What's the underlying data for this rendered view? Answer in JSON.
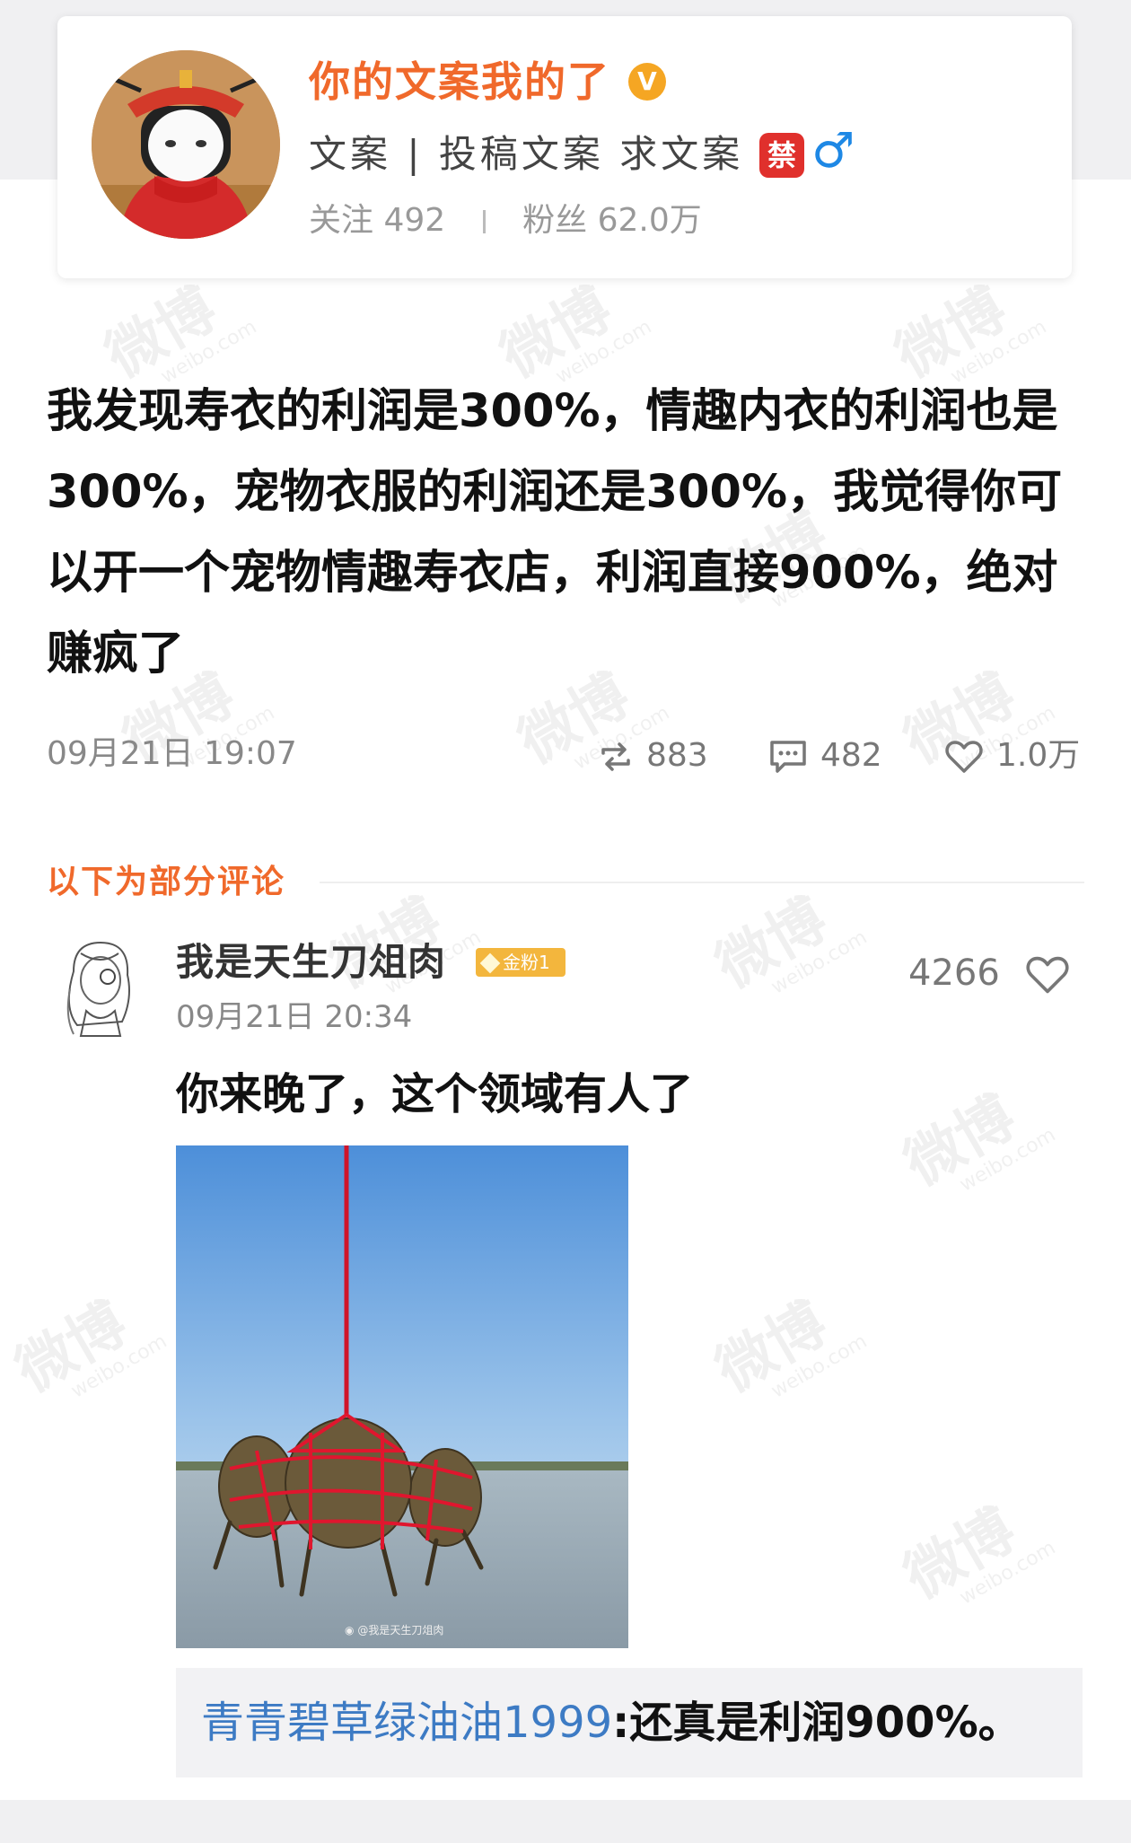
{
  "profile": {
    "username": "你的文案我的了",
    "verified_mark": "V",
    "bio": "文案 | 投稿文案  求文案",
    "ban_badge": "禁",
    "gender_symbol": "♂",
    "following_label": "关注",
    "following_count": "492",
    "fans_label": "粉丝",
    "fans_count": "62.0万"
  },
  "post": {
    "text": "我发现寿衣的利润是300%，情趣内衣的利润也是300%，宠物衣服的利润还是300%，我觉得你可以开一个宠物情趣寿衣店，利润直接900%，绝对赚疯了",
    "timestamp": "09月21日 19:07",
    "reposts": "883",
    "comments": "482",
    "likes": "1.0万"
  },
  "comments_section": {
    "title": "以下为部分评论",
    "comment": {
      "username": "我是天生刀俎肉",
      "badge": "金粉1",
      "timestamp": "09月21日 20:34",
      "likes": "4266",
      "text": "你来晚了，这个领域有人了",
      "image_caption": "@我是天生刀俎肉",
      "reply_user": "青青碧草绿油油1999",
      "reply_text": ":还真是利润900%。"
    }
  },
  "watermark": {
    "big": "微博",
    "small": "weibo.com"
  },
  "icons": [
    "verified-icon",
    "repost-icon",
    "comment-icon",
    "like-icon",
    "weibo-logo-icon"
  ],
  "colors": {
    "accent": "#f0692b",
    "link": "#3d7bc4",
    "gold": "#f3b63d",
    "verified": "#f5a623"
  }
}
